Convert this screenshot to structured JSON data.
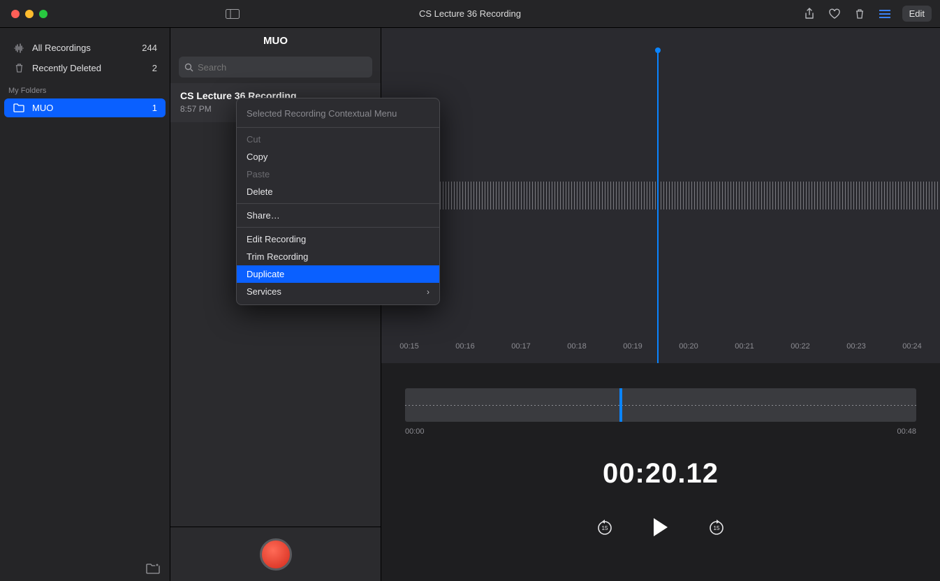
{
  "colors": {
    "accent": "#0a60ff",
    "record": "#d3291a"
  },
  "titlebar": {
    "title": "CS Lecture 36 Recording",
    "edit_label": "Edit"
  },
  "sidebar": {
    "all_recordings": {
      "label": "All Recordings",
      "count": "244"
    },
    "recently_deleted": {
      "label": "Recently Deleted",
      "count": "2"
    },
    "my_folders_header": "My Folders",
    "folders": [
      {
        "label": "MUO",
        "count": "1",
        "selected": true
      }
    ]
  },
  "list": {
    "title": "MUO",
    "search_placeholder": "Search",
    "items": [
      {
        "title": "CS Lecture 36 Recording",
        "time": "8:57 PM"
      }
    ]
  },
  "detail": {
    "ticks": [
      "00:15",
      "00:16",
      "00:17",
      "00:18",
      "00:19",
      "00:20",
      "00:21",
      "00:22",
      "00:23",
      "00:24"
    ],
    "overview": {
      "start": "00:00",
      "end": "00:48"
    },
    "current_time": "00:20.12"
  },
  "context_menu": {
    "title": "Selected Recording Contextual Menu",
    "groups": [
      [
        {
          "label": "Cut",
          "disabled": true
        },
        {
          "label": "Copy"
        },
        {
          "label": "Paste",
          "disabled": true
        },
        {
          "label": "Delete"
        }
      ],
      [
        {
          "label": "Share…"
        }
      ],
      [
        {
          "label": "Edit Recording"
        },
        {
          "label": "Trim Recording"
        },
        {
          "label": "Duplicate",
          "selected": true
        },
        {
          "label": "Services",
          "submenu": true
        }
      ]
    ]
  }
}
